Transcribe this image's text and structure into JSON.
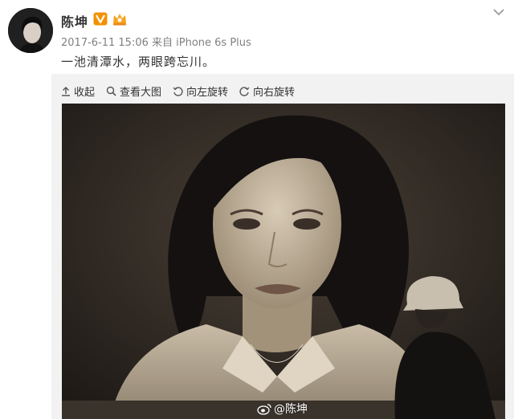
{
  "post": {
    "username": "陈坤",
    "timestamp": "2017-6-11 15:06",
    "source": "来自 iPhone 6s Plus",
    "text": "一池清潭水，两眼跨忘川。"
  },
  "badges": {
    "verified_icon": "verified-v-icon",
    "vip_icon": "vip-crown-icon",
    "verified_color": "#f29100"
  },
  "toolbar": {
    "collapse_label": "收起",
    "view_large_label": "查看大图",
    "rotate_left_label": "向左旋转",
    "rotate_right_label": "向右旋转"
  },
  "photo": {
    "watermark": "@陈坤"
  },
  "colors": {
    "text": "#333333",
    "meta": "#808080",
    "media_background": "#f2f2f2"
  }
}
